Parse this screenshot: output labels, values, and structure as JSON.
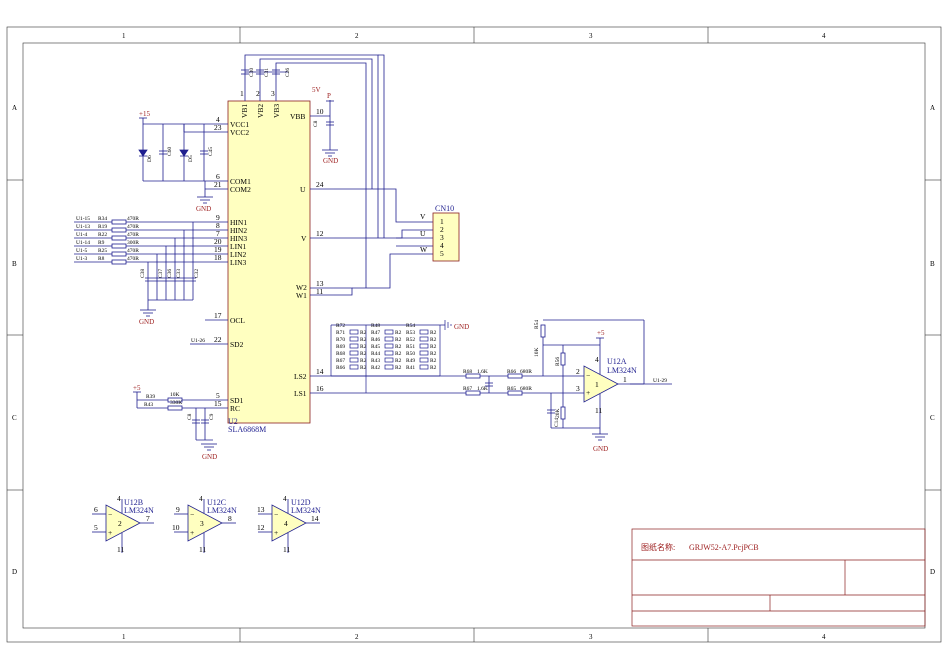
{
  "frame": {
    "columns": [
      "1",
      "2",
      "3",
      "4"
    ],
    "rows": [
      "A",
      "B",
      "C",
      "D"
    ]
  },
  "u2": {
    "designator": "U2",
    "part": "SLA6868M",
    "left_pins": [
      {
        "num": "4",
        "name": "VCC1"
      },
      {
        "num": "23",
        "name": "VCC2"
      },
      {
        "num": "6",
        "name": "COM1"
      },
      {
        "num": "21",
        "name": "COM2"
      },
      {
        "num": "9",
        "name": "HIN1"
      },
      {
        "num": "8",
        "name": "HIN2"
      },
      {
        "num": "7",
        "name": "HIN3"
      },
      {
        "num": "20",
        "name": "LIN1"
      },
      {
        "num": "19",
        "name": "LIN2"
      },
      {
        "num": "18",
        "name": "LIN3"
      },
      {
        "num": "17",
        "name": "OCL"
      },
      {
        "num": "22",
        "name": "SD2"
      },
      {
        "num": "5",
        "name": "SD1"
      },
      {
        "num": "15",
        "name": "RC"
      }
    ],
    "top_pins": [
      {
        "num": "1",
        "name": "VB1"
      },
      {
        "num": "2",
        "name": "VB2"
      },
      {
        "num": "3",
        "name": "VB3"
      }
    ],
    "right_pins": [
      {
        "num": "10",
        "name": "VBB"
      },
      {
        "num": "24",
        "name": "U"
      },
      {
        "num": "12",
        "name": "V"
      },
      {
        "num": "13",
        "name": "W2"
      },
      {
        "num": "11",
        "name": "W1"
      },
      {
        "num": "14",
        "name": "LS2"
      },
      {
        "num": "16",
        "name": "LS1"
      }
    ]
  },
  "inputs": [
    {
      "net": "U1-15",
      "res": "R34",
      "val": "470R"
    },
    {
      "net": "U1-13",
      "res": "R19",
      "val": "470R"
    },
    {
      "net": "U1-4",
      "res": "R22",
      "val": "470R"
    },
    {
      "net": "U1-14",
      "res": "R9",
      "val": "300R"
    },
    {
      "net": "U1-5",
      "res": "R25",
      "val": "470R"
    },
    {
      "net": "U1-3",
      "res": "R8",
      "val": "470R"
    }
  ],
  "sd2_net": "U1-26",
  "rc_network": {
    "supply": "+5",
    "r1": {
      "name": "R39",
      "val": "10K"
    },
    "r2": {
      "name": "R43",
      "val": "330K"
    }
  },
  "power": {
    "plus15": "+15",
    "p_label": "P",
    "vcc_label": "5V",
    "gnd": "GND",
    "plus5": "+5"
  },
  "top_caps": [
    "C30",
    "C31",
    "C26"
  ],
  "vbb_cap": "C8",
  "vcc_parts": [
    "D6",
    "C60",
    "D5",
    "C45"
  ],
  "hin_caps": [
    "C38",
    "C37",
    "C36",
    "C33",
    "C32"
  ],
  "rc_caps": [
    "C8",
    "C9"
  ],
  "connector": {
    "designator": "CN10",
    "pins": [
      "1",
      "2",
      "3",
      "4",
      "5"
    ],
    "labels": [
      "V",
      "U",
      "W"
    ]
  },
  "shunts": {
    "cols": [
      {
        "name": "R72",
        "rows": [
          "R71",
          "R70",
          "R69",
          "R68",
          "R67",
          "R66"
        ]
      },
      {
        "name": "R48",
        "rows": [
          "R47",
          "R46",
          "R45",
          "R44",
          "R43",
          "R42"
        ]
      },
      {
        "name": "R54",
        "rows": [
          "R53",
          "R52",
          "R51",
          "R50",
          "R49",
          "R41"
        ]
      }
    ],
    "value": "R2"
  },
  "amp_net": {
    "r_ls2": {
      "name": "R68",
      "val": "1.6K"
    },
    "r_ls1": {
      "name": "R67",
      "val": "1.6K"
    },
    "r_fb1": {
      "name": "R66",
      "val": "680R"
    },
    "r_fb2": {
      "name": "R65",
      "val": "680R"
    },
    "r_top": "R54",
    "r_bias": {
      "name": "R53",
      "val": "10K"
    },
    "r_mid": "R56",
    "r_bot": {
      "name": "R57",
      "val": "20K"
    },
    "cap": "C14",
    "output_net": "U1-29"
  },
  "opamps": [
    {
      "ref": "U12A",
      "part": "LM324N",
      "unit": "1",
      "pins": {
        "minus": "2",
        "plus": "3",
        "out": "1",
        "vpos": "4",
        "vneg": "11"
      }
    },
    {
      "ref": "U12B",
      "part": "LM324N",
      "unit": "2",
      "pins": {
        "minus": "6",
        "plus": "5",
        "out": "7",
        "vpos": "4",
        "vneg": "11"
      }
    },
    {
      "ref": "U12C",
      "part": "LM324N",
      "unit": "3",
      "pins": {
        "minus": "9",
        "plus": "10",
        "out": "8",
        "vpos": "4",
        "vneg": "11"
      }
    },
    {
      "ref": "U12D",
      "part": "LM324N",
      "unit": "4",
      "pins": {
        "minus": "13",
        "plus": "12",
        "out": "14",
        "vpos": "4",
        "vneg": "11"
      }
    }
  ],
  "title_block": {
    "label": "图纸名称:",
    "value": "GRJW52-A7.PcjPCB"
  },
  "colors": {
    "wire": "#1f1f8f",
    "body": "#ffffc0",
    "border": "#8a1f1f",
    "frame": "#333333"
  }
}
